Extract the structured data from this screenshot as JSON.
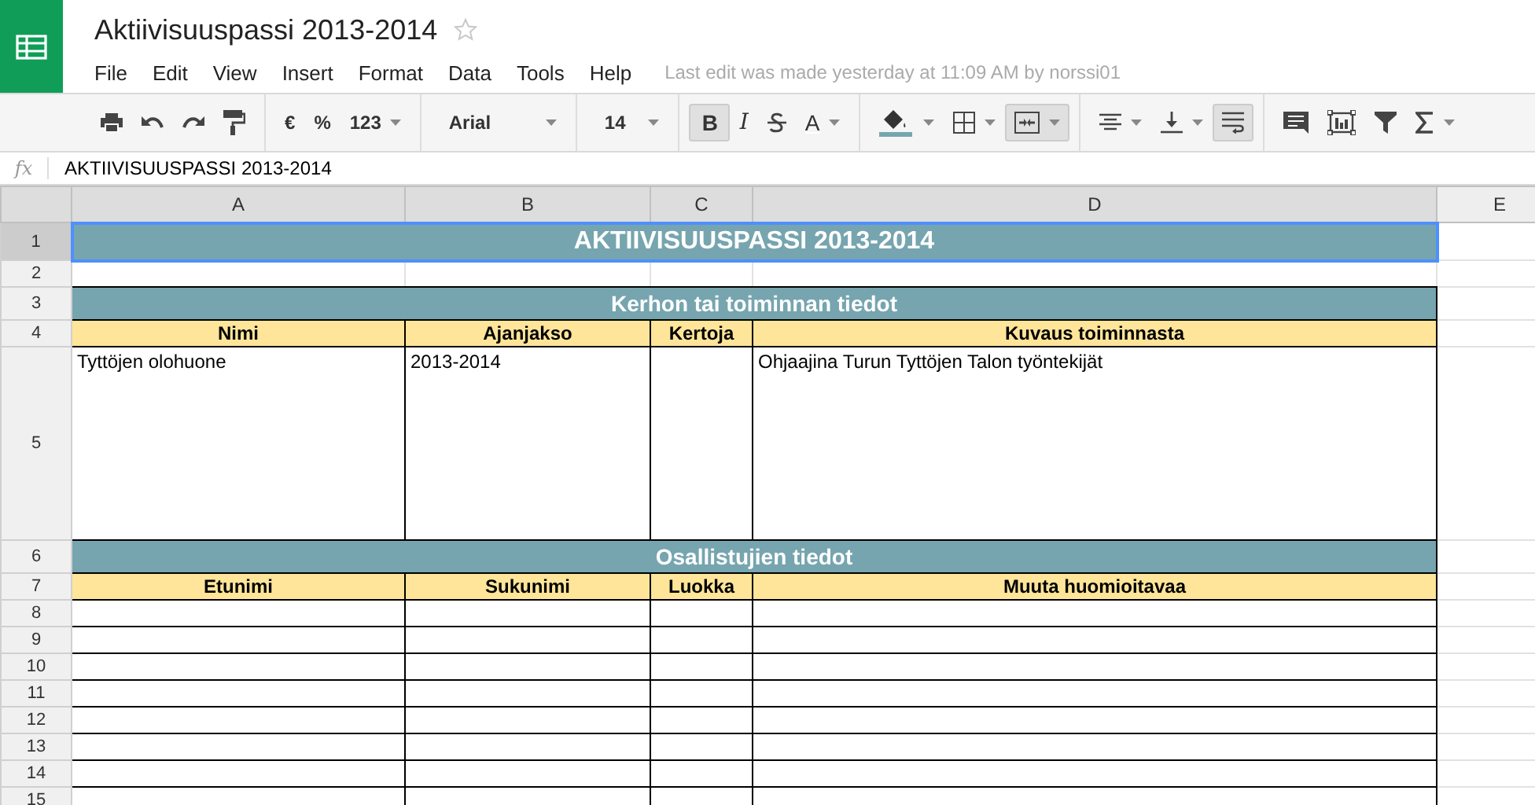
{
  "app": {
    "title": "Aktiivisuuspassi 2013-2014",
    "starred": false,
    "last_edit": "Last edit was made yesterday at 11:09 AM by norssi01"
  },
  "menu": [
    "File",
    "Edit",
    "View",
    "Insert",
    "Format",
    "Data",
    "Tools",
    "Help"
  ],
  "toolbar": [
    {
      "kind": "print",
      "pressed": false
    },
    {
      "kind": "undo",
      "pressed": false
    },
    {
      "kind": "redo",
      "pressed": false
    },
    {
      "kind": "paint-format",
      "pressed": false
    },
    {
      "kind": "sep"
    },
    {
      "kind": "text",
      "label": "€",
      "pressed": false
    },
    {
      "kind": "text",
      "label": "%",
      "pressed": false
    },
    {
      "kind": "text",
      "label": "123",
      "menu": true,
      "pressed": false
    },
    {
      "kind": "sep"
    },
    {
      "kind": "font",
      "label": "Arial",
      "menu": true,
      "pressed": false
    },
    {
      "kind": "sep"
    },
    {
      "kind": "size",
      "label": "14",
      "menu": true,
      "pressed": false
    },
    {
      "kind": "sep"
    },
    {
      "kind": "bold",
      "label": "B",
      "pressed": true
    },
    {
      "kind": "italic",
      "label": "I",
      "pressed": false
    },
    {
      "kind": "strike",
      "pressed": false
    },
    {
      "kind": "text-color",
      "label": "A",
      "menu": true,
      "pressed": false
    },
    {
      "kind": "sep"
    },
    {
      "kind": "fill",
      "menu": true,
      "pressed": false
    },
    {
      "kind": "borders",
      "menu": true,
      "pressed": false
    },
    {
      "kind": "merge",
      "menu": true,
      "pressed": true
    },
    {
      "kind": "sep"
    },
    {
      "kind": "align",
      "menu": true,
      "pressed": false
    },
    {
      "kind": "valign",
      "menu": true,
      "pressed": false
    },
    {
      "kind": "wrap",
      "pressed": true
    },
    {
      "kind": "sep"
    },
    {
      "kind": "comment",
      "pressed": false
    },
    {
      "kind": "chart",
      "pressed": false
    },
    {
      "kind": "filter",
      "pressed": false
    },
    {
      "kind": "sum",
      "menu": true,
      "pressed": false
    }
  ],
  "formula_bar": {
    "label": "fx",
    "value": "AKTIIVISUUSPASSI 2013-2014"
  },
  "columns": [
    {
      "label": "A",
      "selected": true
    },
    {
      "label": "B",
      "selected": true
    },
    {
      "label": "C",
      "selected": true
    },
    {
      "label": "D",
      "selected": true
    },
    {
      "label": "E",
      "selected": false
    }
  ],
  "rows": [
    {
      "number": "1",
      "kind": "title",
      "selected": true,
      "text": "AKTIIVISUUSPASSI 2013-2014"
    },
    {
      "number": "2",
      "kind": "spacer",
      "selected": false
    },
    {
      "number": "3",
      "kind": "section",
      "selected": false,
      "text": "Kerhon tai toiminnan tiedot"
    },
    {
      "number": "4",
      "kind": "header",
      "selected": false,
      "cells": [
        "Nimi",
        "Ajanjakso",
        "Kertoja",
        "Kuvaus toiminnasta"
      ]
    },
    {
      "number": "5",
      "kind": "entry",
      "selected": false,
      "cells": [
        "Tyttöjen olohuone",
        "2013-2014",
        "",
        "Ohjaajina Turun Tyttöjen Talon työntekijät"
      ]
    },
    {
      "number": "6",
      "kind": "section",
      "selected": false,
      "text": "Osallistujien tiedot"
    },
    {
      "number": "7",
      "kind": "header",
      "selected": false,
      "cells": [
        "Etunimi",
        "Sukunimi",
        "Luokka",
        "Muuta huomioitavaa"
      ]
    },
    {
      "number": "8",
      "kind": "empty",
      "selected": false
    },
    {
      "number": "9",
      "kind": "empty",
      "selected": false
    },
    {
      "number": "10",
      "kind": "empty",
      "selected": false
    },
    {
      "number": "11",
      "kind": "empty",
      "selected": false
    },
    {
      "number": "12",
      "kind": "empty",
      "selected": false
    },
    {
      "number": "13",
      "kind": "empty",
      "selected": false
    },
    {
      "number": "14",
      "kind": "empty",
      "selected": false
    },
    {
      "number": "15",
      "kind": "empty",
      "selected": false
    }
  ]
}
